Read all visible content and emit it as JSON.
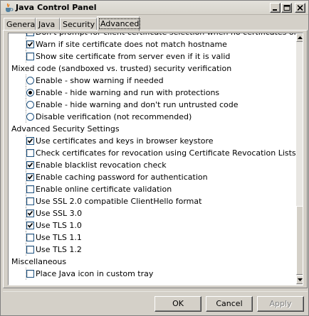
{
  "window": {
    "title": "Java Control Panel",
    "icon": "java-cup-icon"
  },
  "tabs": [
    {
      "label": "General",
      "active": false
    },
    {
      "label": "Java",
      "active": false
    },
    {
      "label": "Security",
      "active": false
    },
    {
      "label": "Advanced",
      "active": true
    }
  ],
  "list": {
    "rows": [
      {
        "type": "check",
        "checked": false,
        "label": "Don't prompt for client certificate selection when no certificates or only one exists"
      },
      {
        "type": "check",
        "checked": true,
        "label": "Warn if site certificate does not match hostname"
      },
      {
        "type": "check",
        "checked": false,
        "label": "Show site certificate from server even if it is valid"
      },
      {
        "type": "header",
        "label": "Mixed code (sandboxed vs. trusted) security verification"
      },
      {
        "type": "radio",
        "checked": false,
        "label": "Enable - show warning if needed"
      },
      {
        "type": "radio",
        "checked": true,
        "label": "Enable - hide warning and run with protections"
      },
      {
        "type": "radio",
        "checked": false,
        "label": "Enable - hide warning and don't run untrusted code"
      },
      {
        "type": "radio",
        "checked": false,
        "label": "Disable verification (not recommended)"
      },
      {
        "type": "header",
        "label": "Advanced Security Settings"
      },
      {
        "type": "check",
        "checked": true,
        "label": "Use certificates and keys in browser keystore"
      },
      {
        "type": "check",
        "checked": false,
        "label": "Check certificates for revocation using Certificate Revocation Lists (CRLs)"
      },
      {
        "type": "check",
        "checked": true,
        "label": "Enable blacklist revocation check"
      },
      {
        "type": "check",
        "checked": true,
        "label": "Enable caching password for authentication"
      },
      {
        "type": "check",
        "checked": false,
        "label": "Enable online certificate validation"
      },
      {
        "type": "check",
        "checked": false,
        "label": "Use SSL 2.0 compatible ClientHello format"
      },
      {
        "type": "check",
        "checked": true,
        "label": "Use SSL 3.0"
      },
      {
        "type": "check",
        "checked": true,
        "label": "Use TLS 1.0"
      },
      {
        "type": "check",
        "checked": false,
        "label": "Use TLS 1.1"
      },
      {
        "type": "check",
        "checked": false,
        "label": "Use TLS 1.2"
      },
      {
        "type": "header",
        "label": "Miscellaneous"
      },
      {
        "type": "check",
        "checked": false,
        "label": "Place Java icon in custom tray"
      }
    ]
  },
  "buttons": {
    "ok": "OK",
    "cancel": "Cancel",
    "apply": "Apply"
  },
  "colors": {
    "window_bg": "#d4d0c8",
    "list_bg": "#ffffff",
    "checkbox_border": "#1c5180"
  }
}
